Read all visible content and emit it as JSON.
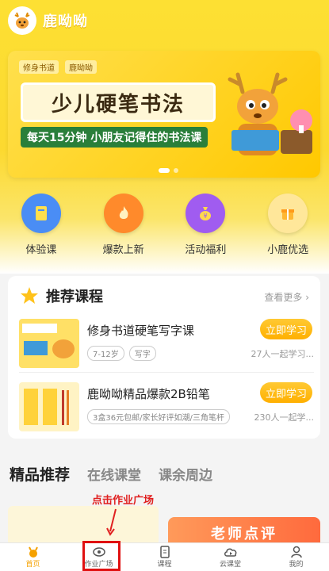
{
  "app": {
    "name": "鹿呦呦"
  },
  "banner": {
    "brands": [
      "修身书道",
      "鹿呦呦"
    ],
    "title": "少儿硬笔书法",
    "subtitle": "每天15分钟 小朋友记得住的书法课"
  },
  "quick_actions": [
    {
      "label": "体验课",
      "icon": "book-icon",
      "color": "#4a8df5"
    },
    {
      "label": "爆款上新",
      "icon": "flame-icon",
      "color": "#ff8a2b"
    },
    {
      "label": "活动福利",
      "icon": "moneybag-icon",
      "color": "#a05cf0"
    },
    {
      "label": "小鹿优选",
      "icon": "gift-icon",
      "color": "#ffb733"
    }
  ],
  "recommended": {
    "title": "推荐课程",
    "more": "查看更多",
    "courses": [
      {
        "title": "修身书道硬笔写字课",
        "tags": [
          "7-12岁",
          "写字"
        ],
        "button": "立即学习",
        "count": "27人一起学习..."
      },
      {
        "title": "鹿呦呦精品爆款2B铅笔",
        "tags": [
          "3盒36元包邮/家长好评如潮/三角笔杆"
        ],
        "button": "立即学习",
        "count": "230人一起学..."
      }
    ]
  },
  "section_tabs": [
    "精品推荐",
    "在线课堂",
    "课余周边"
  ],
  "annotation": "点击作业广场",
  "promo": {
    "right_text": "老师点评"
  },
  "tabbar": [
    {
      "label": "首页",
      "icon": "home-deer-icon"
    },
    {
      "label": "作业广场",
      "icon": "eye-icon"
    },
    {
      "label": "课程",
      "icon": "document-icon"
    },
    {
      "label": "云课堂",
      "icon": "cloud-play-icon"
    },
    {
      "label": "我的",
      "icon": "person-icon"
    }
  ]
}
